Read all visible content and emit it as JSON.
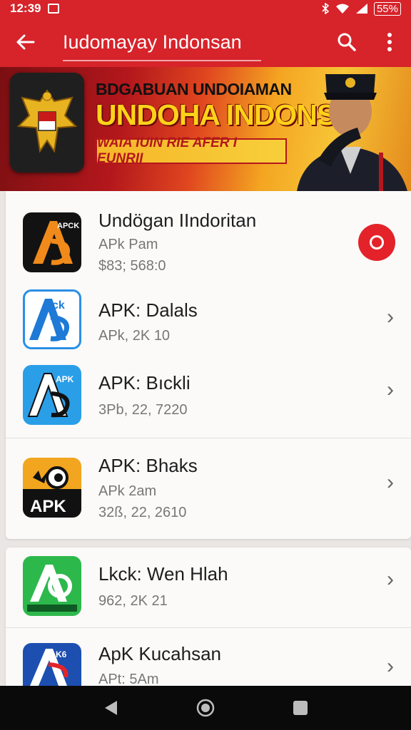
{
  "status": {
    "time": "12:39",
    "battery": "55%"
  },
  "app_bar": {
    "title": "Iudomayay Indonsan",
    "back_icon": "arrow-left-icon",
    "search_icon": "search-icon",
    "menu_icon": "more-vert-icon"
  },
  "banner": {
    "line1": "BDGABUAN UNDOIAMAN",
    "line2": "UNDOHA INDONSIA",
    "ribbon": "WAIA IUIN RIE AFER I EUNRII",
    "emblem_icon": "garuda-emblem-icon"
  },
  "apps": [
    {
      "name": "Undögan IIndoritan",
      "sub1": "APk Pam",
      "sub2": "$83; 568:0",
      "action": "record-button"
    },
    {
      "name": "APK: Dalals",
      "sub1": "APk, 2K 10",
      "sub2": ""
    },
    {
      "name": "APK: Bıckli",
      "sub1": "3Pb, 22, 7220",
      "sub2": ""
    },
    {
      "name": "APK: Bhaks",
      "sub1": "APk 2am",
      "sub2": "32ß, 22, 2610"
    },
    {
      "name": "Lkck: Wen Hlah",
      "sub1": "962, 2K 21",
      "sub2": ""
    },
    {
      "name": "ApK Kucahsan",
      "sub1": "APt: 5Am",
      "sub2": ""
    }
  ],
  "colors": {
    "brand_red": "#d7232a",
    "accent_yellow": "#f7c436"
  },
  "nav": {
    "back_icon": "nav-back-icon",
    "home_icon": "nav-home-icon",
    "recents_icon": "nav-recents-icon"
  }
}
